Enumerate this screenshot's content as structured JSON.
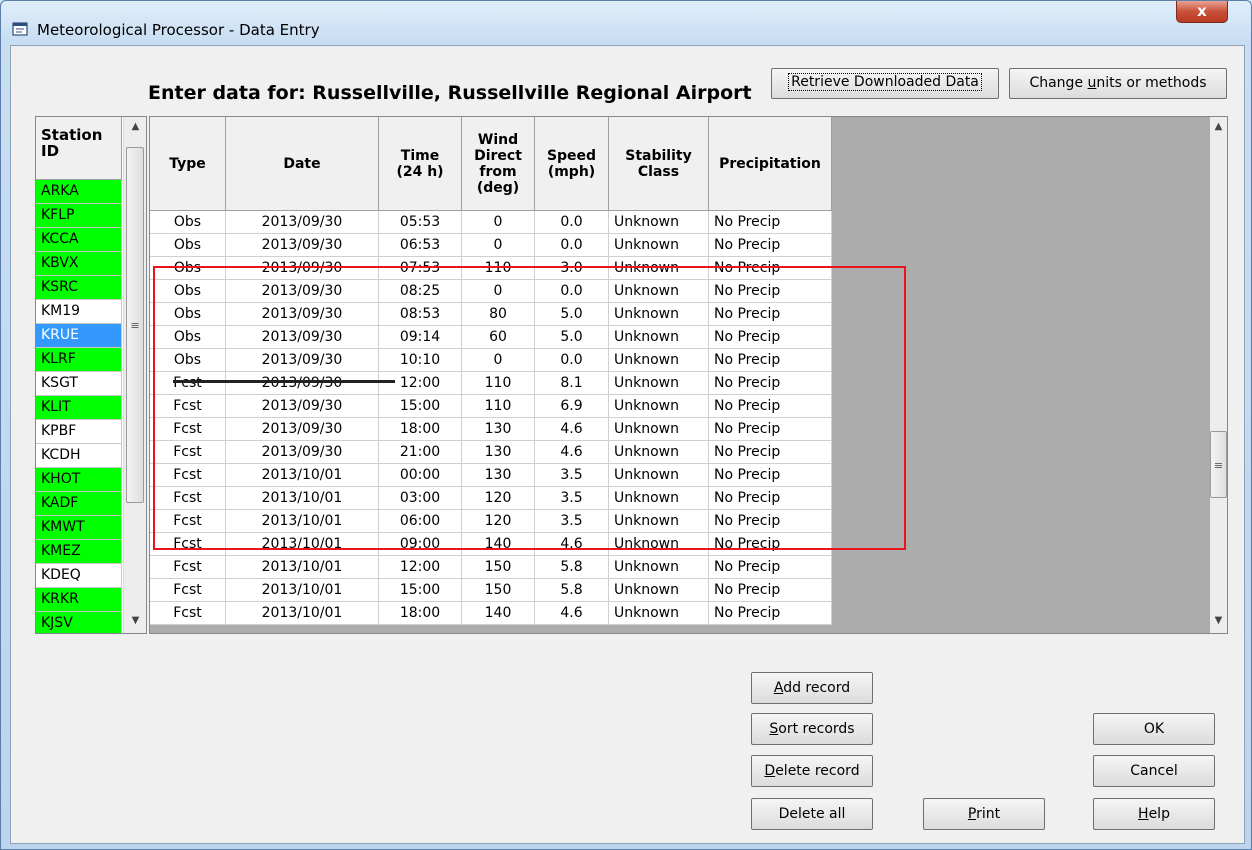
{
  "window": {
    "title": "Meteorological Processor - Data Entry",
    "close_symbol": "x"
  },
  "entry_label": "Enter data for: Russellville, Russellville Regional Airport",
  "buttons": {
    "retrieve": "Retrieve Downloaded Data",
    "units_prefix": "Change ",
    "units_accel": "u",
    "units_suffix": "nits or methods",
    "add_accel": "A",
    "add_rest": "dd record",
    "sort_accel": "S",
    "sort_rest": "ort records",
    "delete_accel": "D",
    "delete_rest": "elete record",
    "delete_all": "Delete all",
    "print_accel": "P",
    "print_rest": "rint",
    "ok": "OK",
    "cancel": "Cancel",
    "help_accel": "H",
    "help_rest": "elp"
  },
  "stations": {
    "header_line1": "Station",
    "header_line2": "ID",
    "items": [
      {
        "id": "ARKA",
        "status": "green"
      },
      {
        "id": "KFLP",
        "status": "green"
      },
      {
        "id": "KCCA",
        "status": "green"
      },
      {
        "id": "KBVX",
        "status": "green"
      },
      {
        "id": "KSRC",
        "status": "green"
      },
      {
        "id": "KM19",
        "status": "white"
      },
      {
        "id": "KRUE",
        "status": "selected"
      },
      {
        "id": "KLRF",
        "status": "green"
      },
      {
        "id": "KSGT",
        "status": "white"
      },
      {
        "id": "KLIT",
        "status": "green"
      },
      {
        "id": "KPBF",
        "status": "white"
      },
      {
        "id": "KCDH",
        "status": "white"
      },
      {
        "id": "KHOT",
        "status": "green"
      },
      {
        "id": "KADF",
        "status": "green"
      },
      {
        "id": "KMWT",
        "status": "green"
      },
      {
        "id": "KMEZ",
        "status": "green"
      },
      {
        "id": "KDEQ",
        "status": "white"
      },
      {
        "id": "KRKR",
        "status": "green"
      },
      {
        "id": "KJSV",
        "status": "green"
      }
    ]
  },
  "grid": {
    "columns": [
      "Type",
      "Date",
      "Time\n(24 h)",
      "Wind\nDirect\nfrom\n(deg)",
      "Speed\n(mph)",
      "Stability\nClass",
      "Precipitation"
    ],
    "rows": [
      [
        "Obs",
        "2013/09/30",
        "05:53",
        "0",
        "0.0",
        "Unknown",
        "No Precip"
      ],
      [
        "Obs",
        "2013/09/30",
        "06:53",
        "0",
        "0.0",
        "Unknown",
        "No Precip"
      ],
      [
        "Obs",
        "2013/09/30",
        "07:53",
        "110",
        "3.0",
        "Unknown",
        "No Precip"
      ],
      [
        "Obs",
        "2013/09/30",
        "08:25",
        "0",
        "0.0",
        "Unknown",
        "No Precip"
      ],
      [
        "Obs",
        "2013/09/30",
        "08:53",
        "80",
        "5.0",
        "Unknown",
        "No Precip"
      ],
      [
        "Obs",
        "2013/09/30",
        "09:14",
        "60",
        "5.0",
        "Unknown",
        "No Precip"
      ],
      [
        "Obs",
        "2013/09/30",
        "10:10",
        "0",
        "0.0",
        "Unknown",
        "No Precip"
      ],
      [
        "Fcst",
        "2013/09/30",
        "12:00",
        "110",
        "8.1",
        "Unknown",
        "No Precip"
      ],
      [
        "Fcst",
        "2013/09/30",
        "15:00",
        "110",
        "6.9",
        "Unknown",
        "No Precip"
      ],
      [
        "Fcst",
        "2013/09/30",
        "18:00",
        "130",
        "4.6",
        "Unknown",
        "No Precip"
      ],
      [
        "Fcst",
        "2013/09/30",
        "21:00",
        "130",
        "4.6",
        "Unknown",
        "No Precip"
      ],
      [
        "Fcst",
        "2013/10/01",
        "00:00",
        "130",
        "3.5",
        "Unknown",
        "No Precip"
      ],
      [
        "Fcst",
        "2013/10/01",
        "03:00",
        "120",
        "3.5",
        "Unknown",
        "No Precip"
      ],
      [
        "Fcst",
        "2013/10/01",
        "06:00",
        "120",
        "3.5",
        "Unknown",
        "No Precip"
      ],
      [
        "Fcst",
        "2013/10/01",
        "09:00",
        "140",
        "4.6",
        "Unknown",
        "No Precip"
      ],
      [
        "Fcst",
        "2013/10/01",
        "12:00",
        "150",
        "5.8",
        "Unknown",
        "No Precip"
      ],
      [
        "Fcst",
        "2013/10/01",
        "15:00",
        "150",
        "5.8",
        "Unknown",
        "No Precip"
      ],
      [
        "Fcst",
        "2013/10/01",
        "18:00",
        "140",
        "4.6",
        "Unknown",
        "No Precip"
      ]
    ]
  },
  "icons": {
    "scroll_up": "▲",
    "scroll_down": "▼",
    "grip": "≡"
  },
  "colors": {
    "station_ok": "#00ff00",
    "station_selected": "#3399ff",
    "highlight": "#e8141e"
  }
}
